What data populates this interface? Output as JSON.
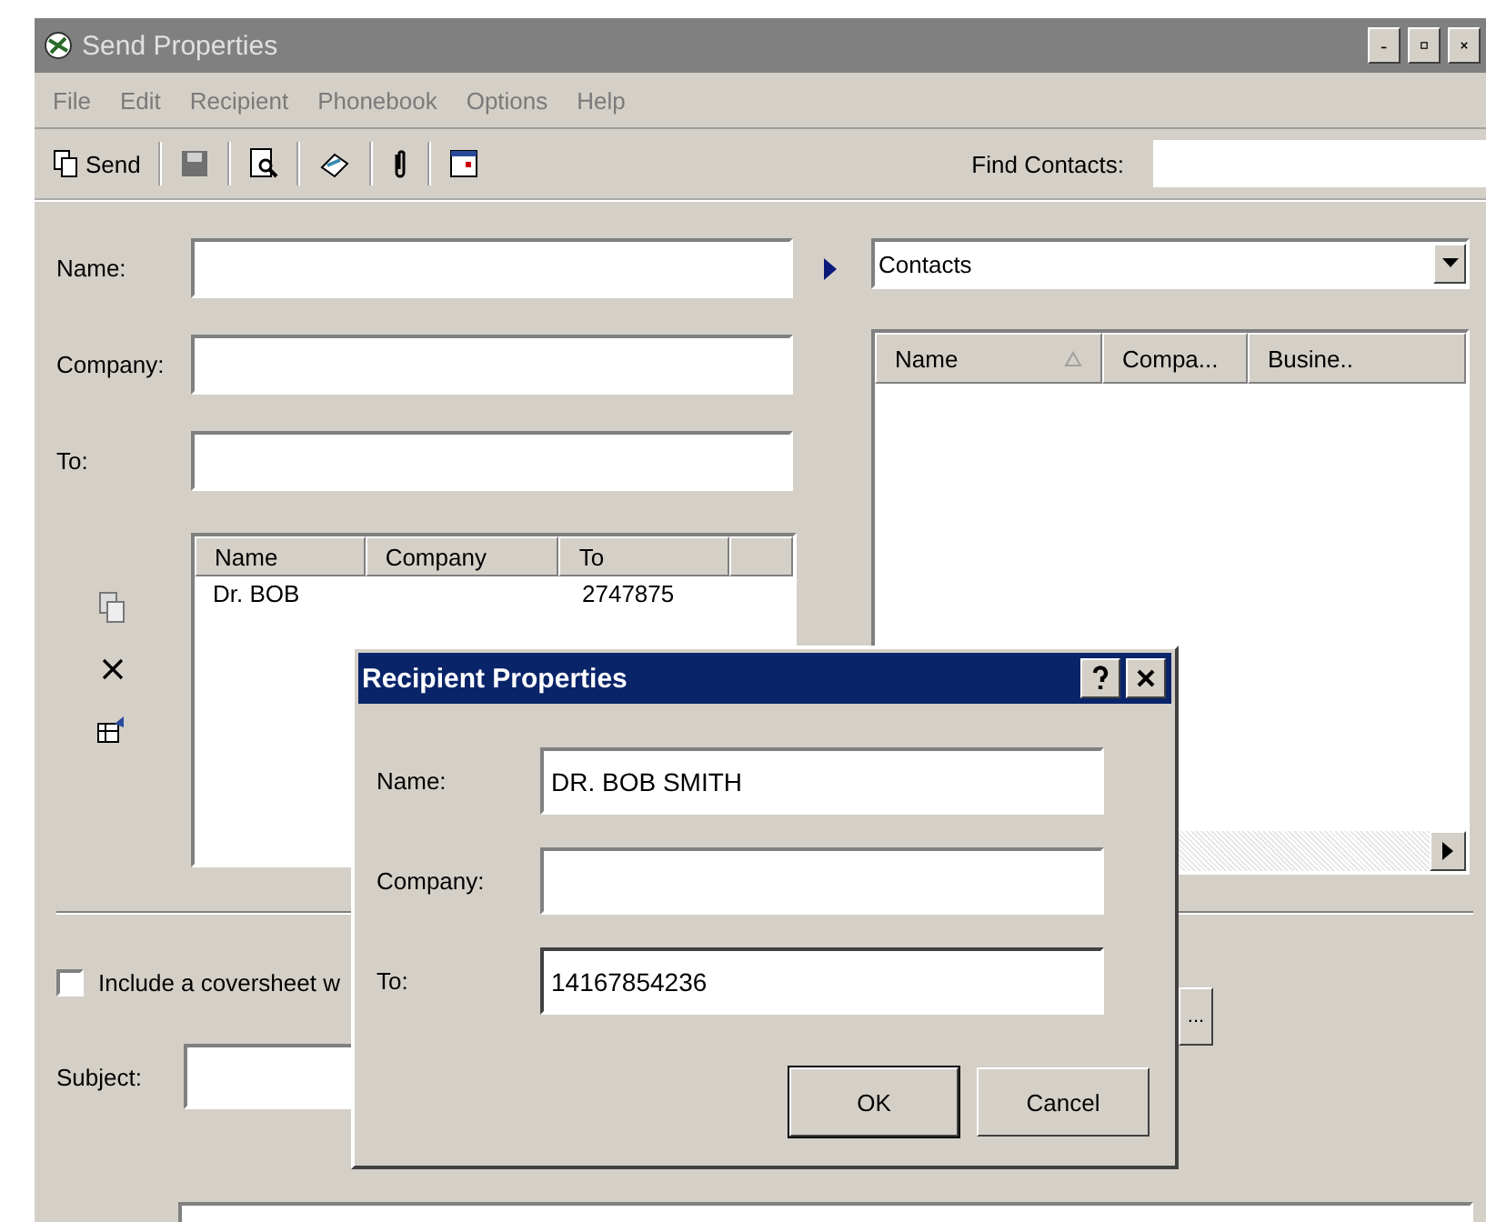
{
  "window": {
    "title": "Send Properties"
  },
  "menu": [
    "File",
    "Edit",
    "Recipient",
    "Phonebook",
    "Options",
    "Help"
  ],
  "toolbar": {
    "send_label": "Send",
    "find_label": "Find Contacts:"
  },
  "fields": [
    {
      "label": "Name:"
    },
    {
      "label": "Company:"
    },
    {
      "label": "To:"
    }
  ],
  "recipients": {
    "columns": [
      "Name",
      "Company",
      "To"
    ],
    "rows": [
      {
        "name": "Dr. BOB",
        "to": "2747875"
      }
    ]
  },
  "coversheet": {
    "label": "Include a coversheet w",
    "checked": false
  },
  "subject": {
    "label": "Subject:"
  },
  "browse_button": "...",
  "contacts": {
    "source": "Contacts",
    "columns": [
      {
        "label": "Name",
        "sorted": true
      },
      {
        "label": "Compa...",
        "sorted": false
      },
      {
        "label": "Busine..",
        "sorted": false
      }
    ]
  },
  "dialog": {
    "title": "Recipient Properties",
    "fields": [
      {
        "label": "Name:",
        "value": "DR. BOB SMITH",
        "focused": false
      },
      {
        "label": "Company:",
        "focused": false
      },
      {
        "label": "To:",
        "value": "14167854236",
        "focused": true
      }
    ],
    "buttons": [
      {
        "label": "OK",
        "default": true
      },
      {
        "label": "Cancel",
        "default": false
      }
    ]
  }
}
